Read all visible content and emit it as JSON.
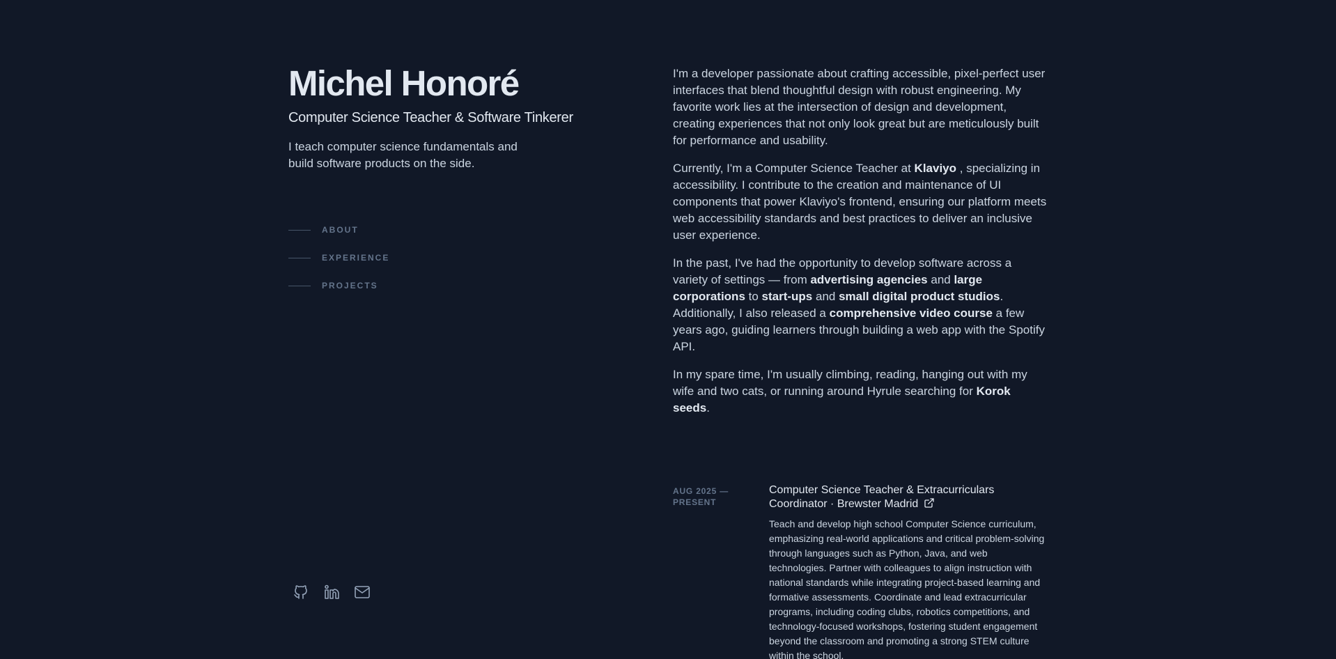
{
  "header": {
    "name": "Michel Honoré",
    "role": "Computer Science Teacher & Software Tinkerer",
    "tagline": "I teach computer science fundamentals and build software products on the side."
  },
  "nav": {
    "items": [
      {
        "label": "ABOUT"
      },
      {
        "label": "EXPERIENCE"
      },
      {
        "label": "PROJECTS"
      }
    ]
  },
  "socials": {
    "icons": [
      "github-icon",
      "linkedin-icon",
      "email-icon"
    ]
  },
  "about": {
    "p1": "I'm a developer passionate about crafting accessible, pixel-perfect user interfaces that blend thoughtful design with robust engineering. My favorite work lies at the intersection of design and development, creating experiences that not only look great but are meticulously built for performance and usability.",
    "p2": {
      "t1": "Currently, I'm a Computer Science Teacher at ",
      "b1": "Klaviyo",
      "t2": " , specializing in accessibility. I contribute to the creation and maintenance of UI components that power Klaviyo's frontend, ensuring our platform meets web accessibility standards and best practices to deliver an inclusive user experience."
    },
    "p3": {
      "t1": "In the past, I've had the opportunity to develop software across a variety of settings — from ",
      "b1": "advertising agencies",
      "t2": " and ",
      "b2": "large corporations",
      "t3": " to ",
      "b3": "start-ups",
      "t4": " and ",
      "b4": "small digital product studios",
      "t5": ". Additionally, I also released a ",
      "b5": "comprehensive video course",
      "t6": " a few years ago, guiding learners through building a web app with the Spotify API."
    },
    "p4": {
      "t1": "In my spare time, I'm usually climbing, reading, hanging out with my wife and two cats, or running around Hyrule searching for ",
      "b1": "Korok seeds",
      "t2": "."
    }
  },
  "experience": {
    "items": [
      {
        "date": "AUG 2025 — PRESENT",
        "title": "Computer Science Teacher & Extracurriculars Coordinator · Brewster Madrid",
        "description": "Teach and develop high school Computer Science curriculum, emphasizing real-world applications and critical problem-solving through languages such as Python, Java, and web technologies. Partner with colleagues to align instruction with national standards while integrating project-based learning and formative assessments. Coordinate and lead extracurricular programs, including coding clubs, robotics competitions, and technology-focused workshops, fostering student engagement beyond the classroom and promoting a strong STEM culture within the school."
      }
    ]
  },
  "colors": {
    "background": "#111827",
    "heading": "#e2e8f0",
    "body": "#cbd5e1",
    "muted": "#64748b"
  }
}
